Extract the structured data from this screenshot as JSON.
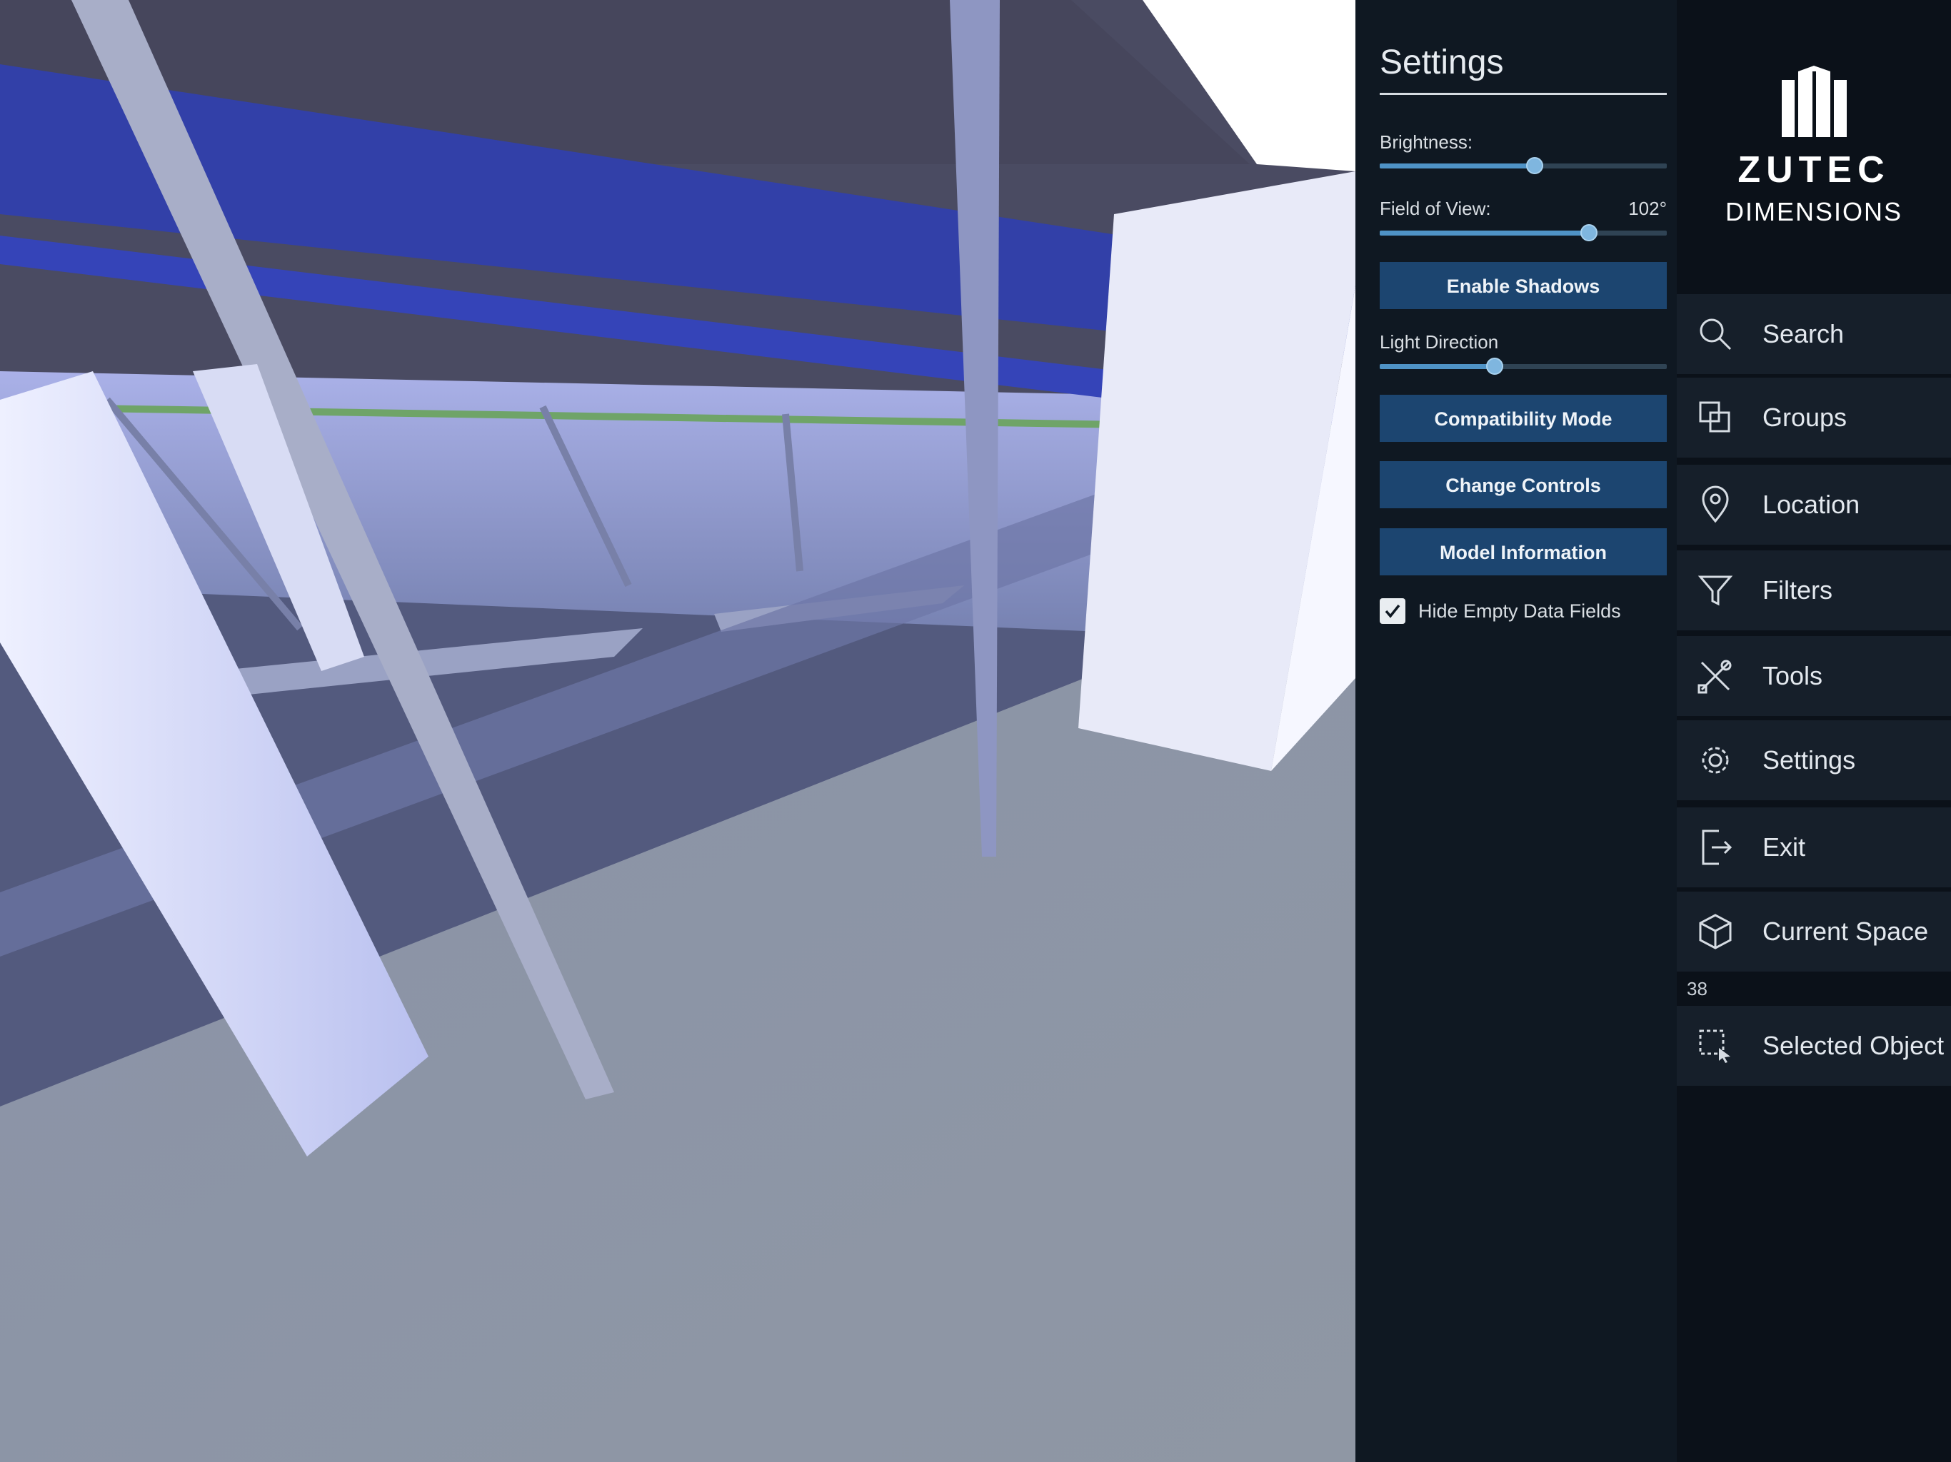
{
  "settings": {
    "title": "Settings",
    "brightness": {
      "label": "Brightness:",
      "value": 0.54
    },
    "field_of_view": {
      "label": "Field of View:",
      "value_text": "102°",
      "value": 0.73
    },
    "enable_shadows_label": "Enable Shadows",
    "light_direction": {
      "label": "Light Direction",
      "value": 0.4
    },
    "compatibility_mode_label": "Compatibility Mode",
    "change_controls_label": "Change Controls",
    "model_information_label": "Model Information",
    "hide_empty": {
      "label": "Hide Empty Data Fields",
      "checked": true
    }
  },
  "brand": {
    "word": "ZUTEC",
    "sub": "DIMENSIONS"
  },
  "nav": {
    "search": "Search",
    "groups": "Groups",
    "location": "Location",
    "filters": "Filters",
    "tools": "Tools",
    "settings": "Settings",
    "exit": "Exit",
    "current_space": "Current Space",
    "count": "38",
    "selected_object": "Selected Object"
  },
  "colors": {
    "button": "#1c4570",
    "slider_fill": "#4f93c7",
    "panel": "#0f1822",
    "nav": "#0b1119"
  }
}
